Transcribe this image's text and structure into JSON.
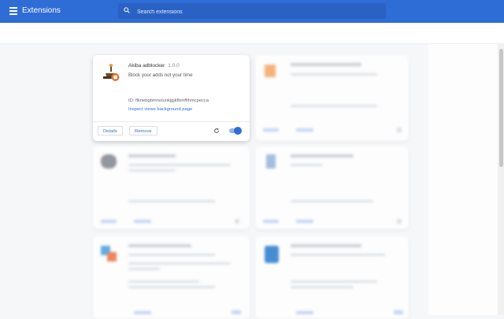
{
  "header": {
    "title": "Extensions",
    "search_placeholder": "Search extensions"
  },
  "extension": {
    "name": "Akiba adblocker",
    "version": "1.0.0",
    "description": "Block your adds not your time",
    "id_text": "ID: flknebgbmnoiunkjgjkfbmffihmcpecca",
    "views_text": "Inspect views background page",
    "details_label": "Details",
    "remove_label": "Remove",
    "enabled": true
  },
  "colors": {
    "brand_blue": "#2f6dd6",
    "toggle_track": "#90b5f0"
  }
}
